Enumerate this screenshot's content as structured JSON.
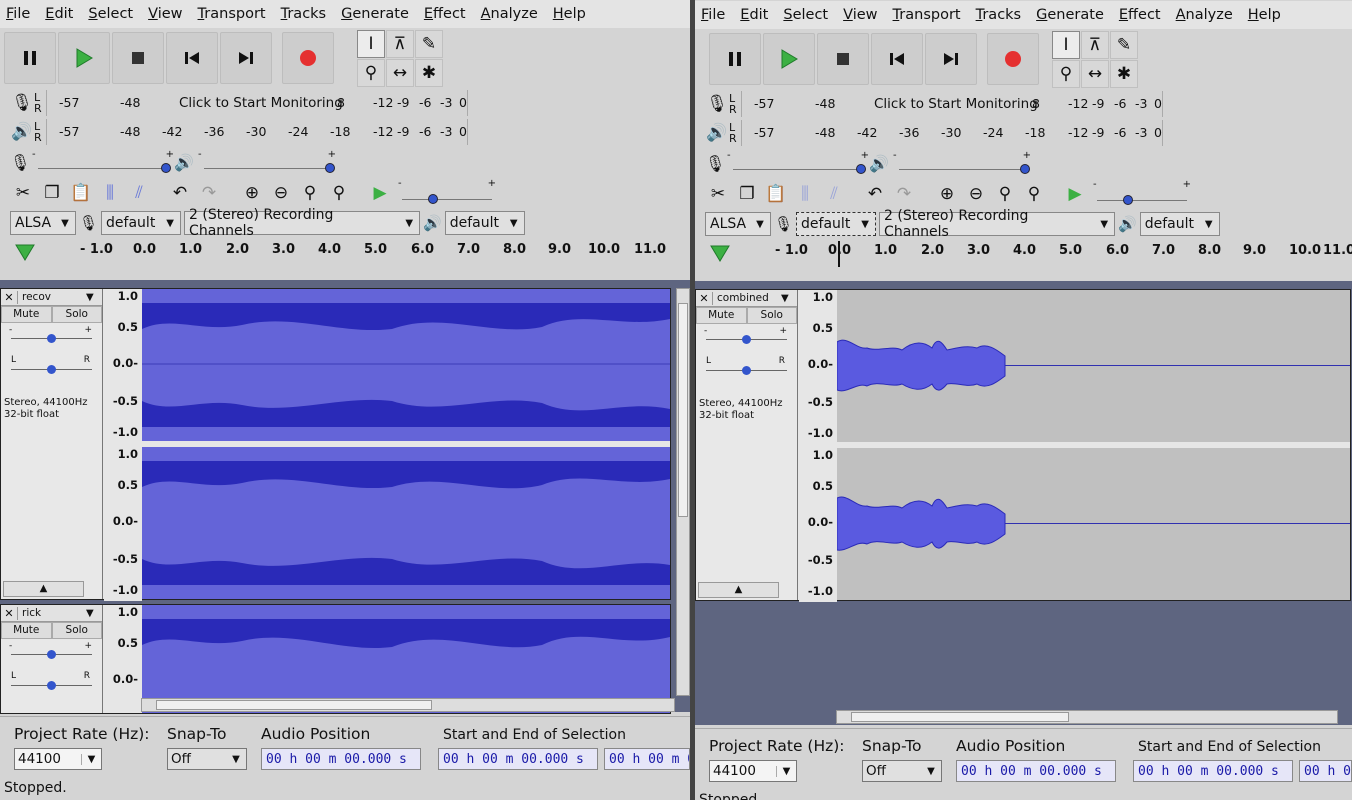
{
  "menu": [
    "File",
    "Edit",
    "Select",
    "View",
    "Transport",
    "Tracks",
    "Generate",
    "Effect",
    "Analyze",
    "Help"
  ],
  "transport_icons": [
    "pause-icon",
    "play-icon",
    "stop-icon",
    "skip-start-icon",
    "skip-end-icon",
    "record-icon"
  ],
  "tool_icons": [
    "selection-tool-icon",
    "envelope-tool-icon",
    "draw-tool-icon",
    "zoom-tool-icon",
    "timeshift-tool-icon",
    "multi-tool-icon"
  ],
  "meter": {
    "lr_l": "L",
    "lr_r": "R",
    "record_ticks_left": [
      "-57",
      "-48"
    ],
    "monitor_text": "Click to Start Monitoring",
    "monitor_tail": "8",
    "record_ticks_right": [
      "-12",
      "-9",
      "-6",
      "-3",
      "0"
    ],
    "play_ticks": [
      "-57",
      "-48",
      "-42",
      "-36",
      "-30",
      "-24",
      "-18",
      "-12",
      "-9",
      "-6",
      "-3",
      "0"
    ]
  },
  "slider_plus": "+",
  "slider_minus": "-",
  "device": {
    "host": "ALSA",
    "record_device": "default",
    "channels": "2 (Stereo) Recording Channels",
    "play_device": "default"
  },
  "ruler_ticks": [
    "- 1.0",
    "0.0",
    "1.0",
    "2.0",
    "3.0",
    "4.0",
    "5.0",
    "6.0",
    "7.0",
    "8.0",
    "9.0",
    "10.0",
    "11.0"
  ],
  "amp_labels": [
    "1.0",
    "0.5",
    "0.0-",
    "-0.5",
    "-1.0"
  ],
  "left_window": {
    "tracks": [
      {
        "name": "recov",
        "mute": "Mute",
        "solo": "Solo",
        "gain_minus": "-",
        "gain_plus": "+",
        "pan_l": "L",
        "pan_r": "R",
        "format1": "Stereo, 44100Hz",
        "format2": "32-bit float"
      },
      {
        "name": "rick",
        "mute": "Mute",
        "solo": "Solo",
        "gain_minus": "-",
        "gain_plus": "+",
        "pan_l": "L",
        "pan_r": "R"
      }
    ],
    "status": "Stopped."
  },
  "right_window": {
    "tracks": [
      {
        "name": "combined",
        "mute": "Mute",
        "solo": "Solo",
        "gain_minus": "-",
        "gain_plus": "+",
        "pan_l": "L",
        "pan_r": "R",
        "format1": "Stereo, 44100Hz",
        "format2": "32-bit float"
      }
    ],
    "status": "Stopped."
  },
  "selection_bar": {
    "project_rate_label": "Project Rate (Hz):",
    "project_rate": "44100",
    "snap_label": "Snap-To",
    "snap_value": "Off",
    "audio_pos_label": "Audio Position",
    "audio_pos": "00 h 00 m 00.000 s",
    "sel_label": "Start and End of Selection",
    "sel_start": "00 h 00 m 00.000 s",
    "sel_end": "00 h 00 m 0"
  },
  "colors": {
    "waveform": "#6464d8",
    "waveform_dark": "#2a2ab8",
    "track_bg": "#5e6580",
    "record": "#e53030",
    "play": "#3cb043"
  }
}
